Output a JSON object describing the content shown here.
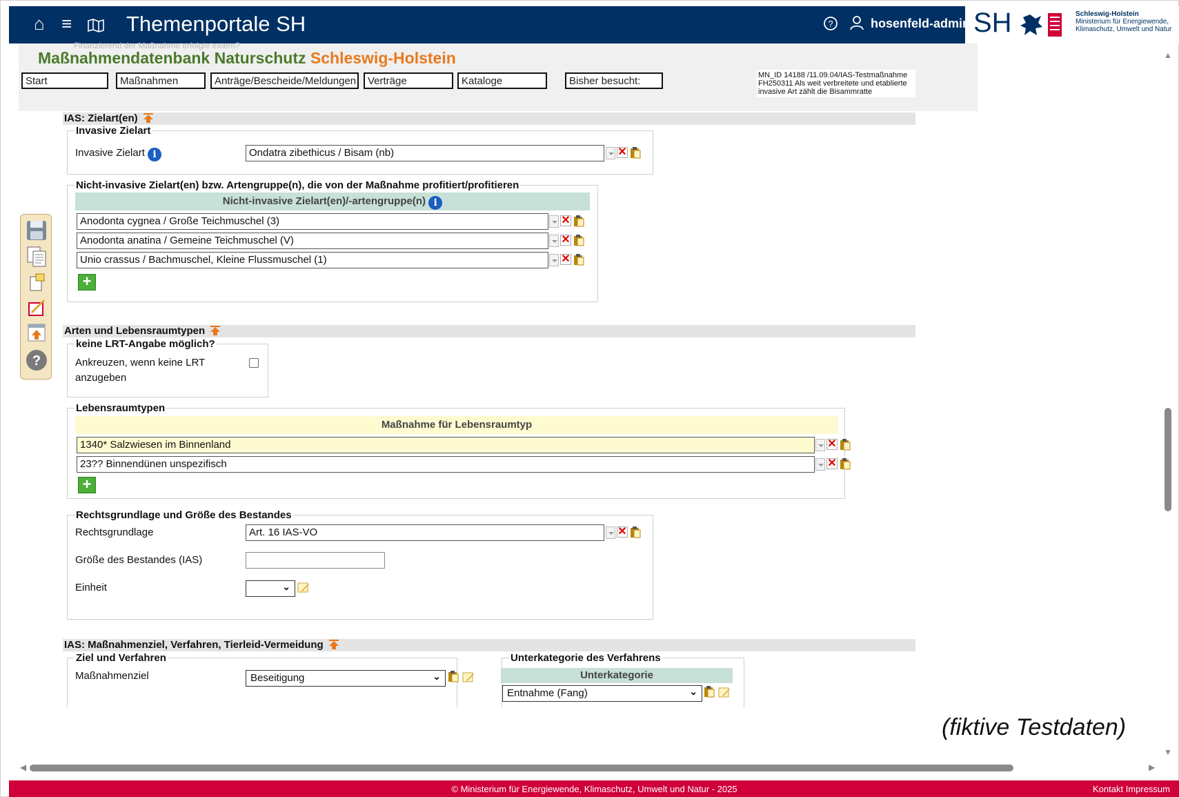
{
  "topbar": {
    "title": "Themenportale SH",
    "user": "hosenfeld-admin",
    "logo_sh": "SH",
    "org_name": "Schleswig-Holstein",
    "org_line1": "Ministerium für Energiewende,",
    "org_line2": "Klimaschutz, Umwelt und Natur"
  },
  "banner": {
    "title_green": "Maßnahmendatenbank Naturschutz",
    "title_orange": "Schleswig-Holstein",
    "ghost": "Finanzierend der Maßnahme erfolgte extern?",
    "nav": [
      "Start",
      "Maßnahmen",
      "Anträge/Bescheide/Meldungen",
      "Verträge",
      "Kataloge",
      "Bisher besucht:"
    ],
    "info": "MN_ID 14188 /11.09.04/IAS-Testmaßnahme FH250311 Als weit verbreitete und etablierte invasive Art zählt die Bisammratte"
  },
  "sec_ias": {
    "heading": "IAS: Zielart(en)",
    "invasive_legend": "Invasive Zielart",
    "invasive_label": "Invasive Zielart",
    "invasive_value": "Ondatra zibethicus / Bisam (nb)",
    "noninv_legend": "Nicht-invasive Zielart(en) bzw. Artengruppe(n), die von der Maßnahme profitiert/profitieren",
    "noninv_header": "Nicht-invasive Zielart(en)/-artengruppe(n)",
    "noninv_rows": [
      "Anodonta cygnea / Große Teichmuschel (3)",
      "Anodonta anatina / Gemeine Teichmuschel (V)",
      "Unio crassus / Bachmuschel, Kleine Flussmuschel (1)"
    ]
  },
  "sec_arten": {
    "heading": "Arten und Lebensraumtypen",
    "lrt_legend": "keine LRT-Angabe möglich?",
    "lrt_label1": "Ankreuzen, wenn keine LRT",
    "lrt_label2": "anzugeben",
    "lebens_legend": "Lebensraumtypen",
    "lebens_header": "Maßnahme für Lebensraumtyp",
    "lebens_rows": [
      "1340* Salzwiesen im Binnenland",
      "23?? Binnendünen unspezifisch"
    ],
    "recht_legend": "Rechtsgrundlage und Größe des Bestandes",
    "recht_label": "Rechtsgrundlage",
    "recht_value": "Art. 16 IAS-VO",
    "groesse_label": "Größe des Bestandes (IAS)",
    "groesse_value": "",
    "einheit_label": "Einheit",
    "einheit_value": ""
  },
  "sec_ziel": {
    "heading": "IAS: Maßnahmenziel, Verfahren, Tierleid-Vermeidung",
    "ziel_legend": "Ziel und Verfahren",
    "ziel_label": "Maßnahmenziel",
    "ziel_value": "Beseitigung",
    "unter_legend": "Unterkategorie des Verfahrens",
    "unter_header": "Unterkategorie",
    "unter_value": "Entnahme (Fang)"
  },
  "watermark": "(fiktive Testdaten)",
  "footer": {
    "copyright": "© Ministerium für Energiewende, Klimaschutz, Umwelt und Natur - 2025",
    "kontakt": "Kontakt",
    "impressum": "Impressum"
  },
  "colors": {
    "topbar": "#003064",
    "footer": "#d0003b",
    "banner_green": "#4a7a2a",
    "banner_orange": "#e8791e"
  },
  "icons": [
    "home-icon",
    "menu-icon",
    "map-icon",
    "help-icon",
    "user-icon",
    "save-icon",
    "copy-icon",
    "new-doc-icon",
    "edit-icon",
    "upload-icon",
    "question-icon",
    "info-icon",
    "delete-icon",
    "clipboard-icon",
    "add-icon",
    "note-icon",
    "section-up-icon"
  ]
}
